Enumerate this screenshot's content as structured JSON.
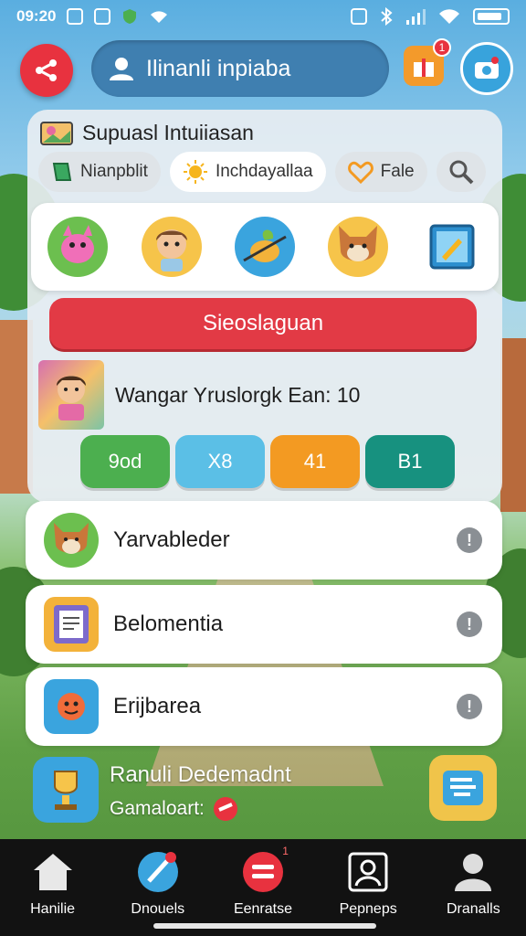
{
  "status_bar": {
    "time": "09:20"
  },
  "top_bar": {
    "search_text": "Ilinanli inpiaba",
    "notification_count": "1"
  },
  "panel": {
    "title": "Supuasl Intuiiasan",
    "chips": [
      {
        "label": "Nianpblit"
      },
      {
        "label": "Inchdayallaa"
      },
      {
        "label": "Fale"
      }
    ],
    "primary_button": "Sieoslaguan",
    "profile_text": "Wangar Yruslorgk Ean: 10",
    "stats": [
      {
        "label": "9od",
        "color": "#4caf4f"
      },
      {
        "label": "X8",
        "color": "#5bbfe6"
      },
      {
        "label": "41",
        "color": "#f39a22"
      },
      {
        "label": "B1",
        "color": "#17917f"
      }
    ]
  },
  "list": {
    "items": [
      {
        "label": "Yarvableder"
      },
      {
        "label": "Belomentia"
      },
      {
        "label": "Erijbarea"
      }
    ]
  },
  "promo": {
    "title": "Ranuli Dedemadnt",
    "subtitle": "Gamaloart:"
  },
  "nav": {
    "items": [
      {
        "label": "Hanilie"
      },
      {
        "label": "Dnouels"
      },
      {
        "label": "Eenratse"
      },
      {
        "label": "Pepneps"
      },
      {
        "label": "Dranalls"
      }
    ],
    "badge": "1"
  }
}
